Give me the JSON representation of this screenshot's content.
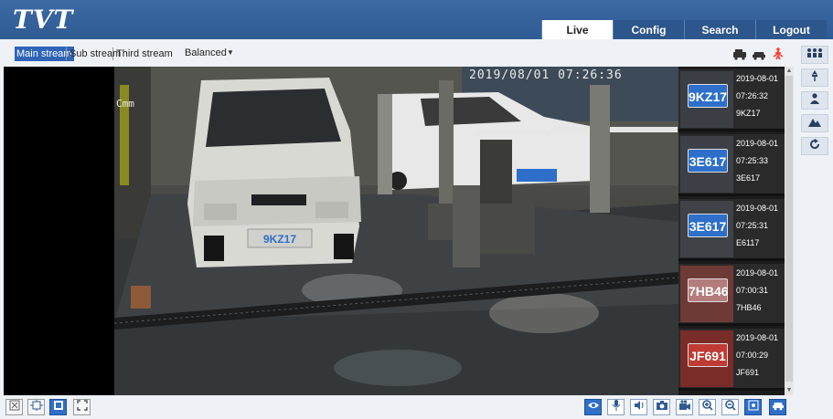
{
  "header": {
    "logo": "TVT",
    "nav": [
      "Live",
      "Config",
      "Search",
      "Logout"
    ]
  },
  "toolbar": {
    "streams": [
      "Main stream",
      "Sub stream",
      "Third stream"
    ],
    "quality": "Balanced",
    "right_icons": [
      "vehicle-detect-icon",
      "car-icon",
      "person-alarm-icon"
    ]
  },
  "video": {
    "osd_time": "2019/08/01 07:26:36",
    "osd_left": "Cmm"
  },
  "captures": [
    {
      "plate": "9KZ17",
      "date": "2019-08-01",
      "time": "07:26:32",
      "plate_text": "9KZ17",
      "plate_color": "#2d6fc9"
    },
    {
      "plate": "3E617",
      "date": "2019-08-01",
      "time": "07:25:33",
      "plate_text": "3E617",
      "plate_color": "#2d6fc9"
    },
    {
      "plate": "3E617",
      "date": "2019-08-01",
      "time": "07:25:31",
      "plate_text": "E6117",
      "plate_color": "#2d6fc9"
    },
    {
      "plate": "7HB46",
      "date": "2019-08-01",
      "time": "07:00:31",
      "plate_text": "7HB46",
      "plate_color": "#b47c7c"
    },
    {
      "plate": "JF691",
      "date": "2019-08-01",
      "time": "07:00:29",
      "plate_text": "JF691",
      "plate_color": "#c03b34"
    }
  ],
  "side_buttons": [
    "people-group-icon",
    "pin-icon",
    "person-icon",
    "mountain-icon",
    "refresh-icon"
  ],
  "bottom_left": [
    "close-window-icon",
    "fit-window-icon",
    "single-view-icon",
    "fullscreen-icon"
  ],
  "bottom_right": [
    "eye-icon",
    "microphone-icon",
    "speaker-icon",
    "snapshot-icon",
    "record-icon",
    "zoom-in-icon",
    "zoom-out-icon",
    "ptz-icon",
    "vehicle-icon"
  ],
  "colors": {
    "header": "#2f5b93",
    "active_stream": "#2f64b8",
    "accent_blue": "#2f6fc8",
    "alarm_red": "#ff3b2f"
  }
}
